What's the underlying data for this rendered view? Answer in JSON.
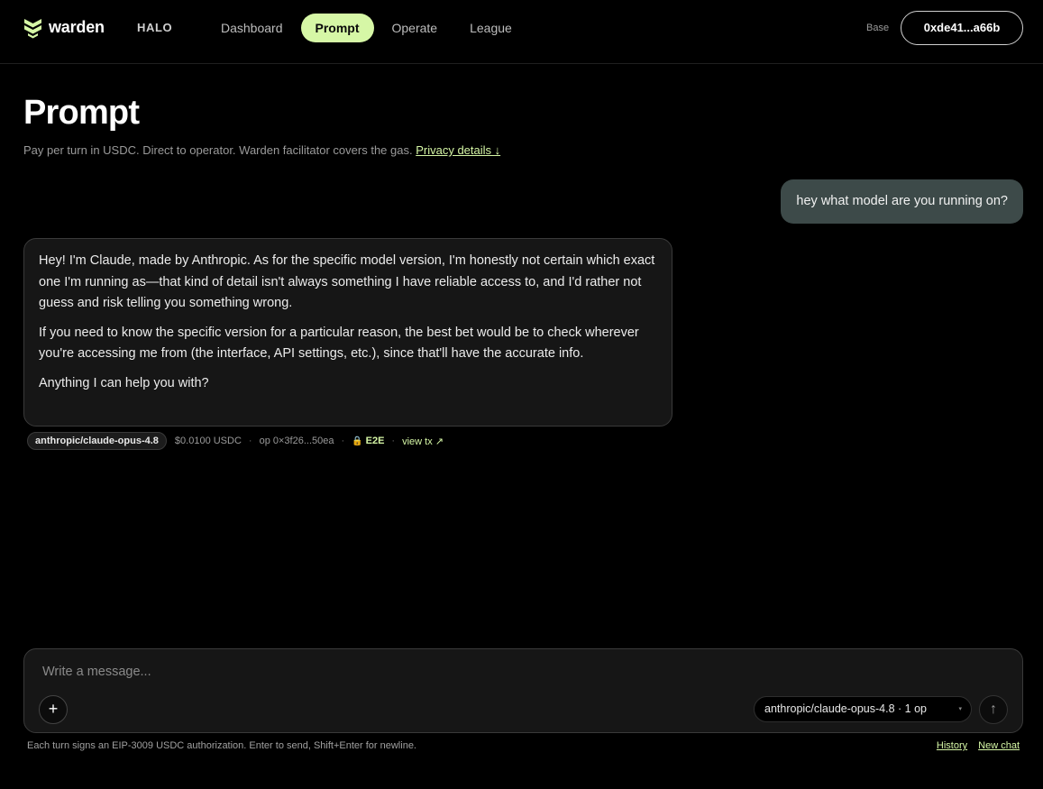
{
  "header": {
    "brand": "warden",
    "section": "HALO",
    "nav": [
      {
        "label": "Dashboard"
      },
      {
        "label": "Prompt"
      },
      {
        "label": "Operate"
      },
      {
        "label": "League"
      }
    ],
    "active_nav": "Prompt",
    "network": "Base",
    "wallet": "0xde41...a66b"
  },
  "page": {
    "title": "Prompt",
    "subtitle": "Pay per turn in USDC. Direct to operator. Warden facilitator covers the gas.",
    "privacy_link": "Privacy details ↓"
  },
  "chat": {
    "user_message": "hey what model are you running on?",
    "assistant_paragraphs": [
      "Hey! I'm Claude, made by Anthropic. As for the specific model version, I'm honestly not certain which exact one I'm running as—that kind of detail isn't always something I have reliable access to, and I'd rather not guess and risk telling you something wrong.",
      "If you need to know the specific version for a particular reason, the best bet would be to check wherever you're accessing me from (the interface, API settings, etc.), since that'll have the accurate info.",
      "Anything I can help you with?"
    ],
    "meta": {
      "model": "anthropic/claude-opus-4.8",
      "price": "$0.0100 USDC",
      "operator": "op 0×3f26...50ea",
      "e2e": "E2E",
      "view_tx": "view tx ↗"
    }
  },
  "composer": {
    "placeholder": "Write a message...",
    "plus": "+",
    "model_select": "anthropic/claude-opus-4.8 · 1 op",
    "send": "↑"
  },
  "footer": {
    "note": "Each turn signs an EIP-3009 USDC authorization. Enter to send, Shift+Enter for newline.",
    "history": "History",
    "new_chat": "New chat"
  },
  "colors": {
    "accent": "#d6f7a6",
    "background": "#000000",
    "user_bubble": "#3d4a49",
    "assistant_bubble": "#161616"
  },
  "icons": {
    "logo": "warden-logo-icon",
    "lock": "lock-icon",
    "send": "arrow-up-icon",
    "add": "plus-icon"
  }
}
